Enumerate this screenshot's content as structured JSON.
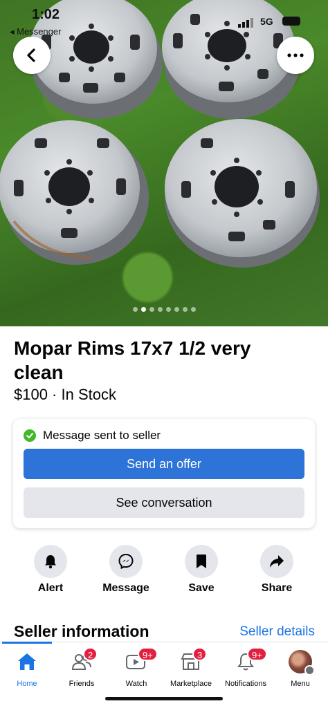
{
  "status_bar": {
    "time": "1:02",
    "back_app": "◂ Messenger",
    "network": "5G"
  },
  "listing": {
    "title": "Mopar Rims 17x7 1/2 very clean",
    "price_line": "$100 · In Stock",
    "photo_count": 8,
    "active_photo": 2
  },
  "message_card": {
    "status": "Message sent to seller",
    "offer_button": "Send an offer",
    "conversation_button": "See conversation"
  },
  "actions": [
    {
      "label": "Alert",
      "icon": "bell-icon"
    },
    {
      "label": "Message",
      "icon": "messenger-icon"
    },
    {
      "label": "Save",
      "icon": "bookmark-icon"
    },
    {
      "label": "Share",
      "icon": "share-icon"
    }
  ],
  "seller": {
    "heading": "Seller information",
    "link": "Seller details"
  },
  "tabbar": [
    {
      "label": "Home",
      "icon": "home-icon",
      "badge": ""
    },
    {
      "label": "Friends",
      "icon": "friends-icon",
      "badge": "2"
    },
    {
      "label": "Watch",
      "icon": "watch-icon",
      "badge": "9+"
    },
    {
      "label": "Marketplace",
      "icon": "marketplace-icon",
      "badge": "3"
    },
    {
      "label": "Notifications",
      "icon": "bell-icon",
      "badge": "9+"
    },
    {
      "label": "Menu",
      "icon": "avatar",
      "badge": ""
    }
  ],
  "colors": {
    "accent": "#1b74e4",
    "primary_button": "#2d73d8",
    "badge": "#e41e3f",
    "success": "#42b72a"
  }
}
